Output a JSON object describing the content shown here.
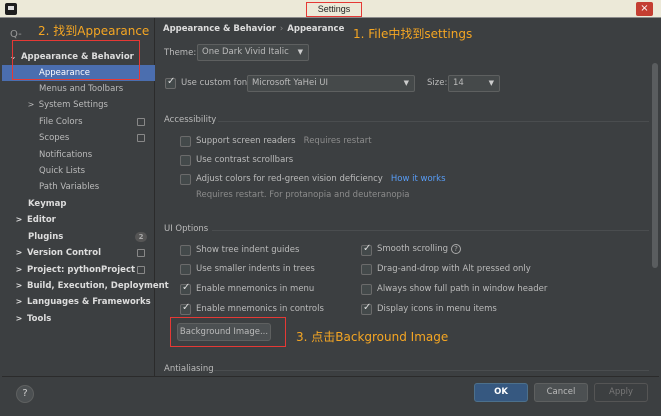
{
  "window": {
    "title": "Settings",
    "close": "×"
  },
  "sidebar": {
    "search_icon": "Q-",
    "items": [
      {
        "label": "Appearance & Behavior",
        "arrow": "⌄"
      },
      {
        "label": "Appearance"
      },
      {
        "label": "Menus and Toolbars"
      },
      {
        "label": "System Settings",
        "arrow": ">"
      },
      {
        "label": "File Colors"
      },
      {
        "label": "Scopes"
      },
      {
        "label": "Notifications"
      },
      {
        "label": "Quick Lists"
      },
      {
        "label": "Path Variables"
      },
      {
        "label": "Keymap"
      },
      {
        "label": "Editor",
        "arrow": ">"
      },
      {
        "label": "Plugins",
        "badge": "2"
      },
      {
        "label": "Version Control",
        "arrow": ">"
      },
      {
        "label": "Project: pythonProject",
        "arrow": ">"
      },
      {
        "label": "Build, Execution, Deployment",
        "arrow": ">"
      },
      {
        "label": "Languages & Frameworks",
        "arrow": ">"
      },
      {
        "label": "Tools",
        "arrow": ">"
      }
    ]
  },
  "annotations": {
    "step1": "1. File中找到settings",
    "step2": "2. 找到Appearance",
    "step3": "3. 点击Background Image"
  },
  "main": {
    "breadcrumb": {
      "root": "Appearance & Behavior",
      "sep": "›",
      "leaf": "Appearance"
    },
    "theme": {
      "label": "Theme:",
      "value": "One Dark Vivid Italic"
    },
    "font": {
      "checkbox_label": "Use custom font:",
      "value": "Microsoft YaHei UI",
      "size_label": "Size:",
      "size_value": "14"
    },
    "accessibility": {
      "title": "Accessibility",
      "screen_readers": "Support screen readers",
      "requires_restart": "Requires restart",
      "contrast_scrollbars": "Use contrast scrollbars",
      "adjust_colors": "Adjust colors for red-green vision deficiency",
      "how_it_works": "How it works",
      "adjust_hint": "Requires restart. For protanopia and deuteranopia"
    },
    "ui_options": {
      "title": "UI Options",
      "tree_indent": "Show tree indent guides",
      "smooth_scrolling": "Smooth scrolling",
      "smaller_indents": "Use smaller indents in trees",
      "drag_drop": "Drag-and-drop with Alt pressed only",
      "mnemonics_menu": "Enable mnemonics in menu",
      "full_path": "Always show full path in window header",
      "mnemonics_controls": "Enable mnemonics in controls",
      "display_icons": "Display icons in menu items",
      "background_image": "Background Image..."
    },
    "antialiasing": "Antialiasing"
  },
  "footer": {
    "help": "?",
    "ok": "OK",
    "cancel": "Cancel",
    "apply": "Apply"
  }
}
